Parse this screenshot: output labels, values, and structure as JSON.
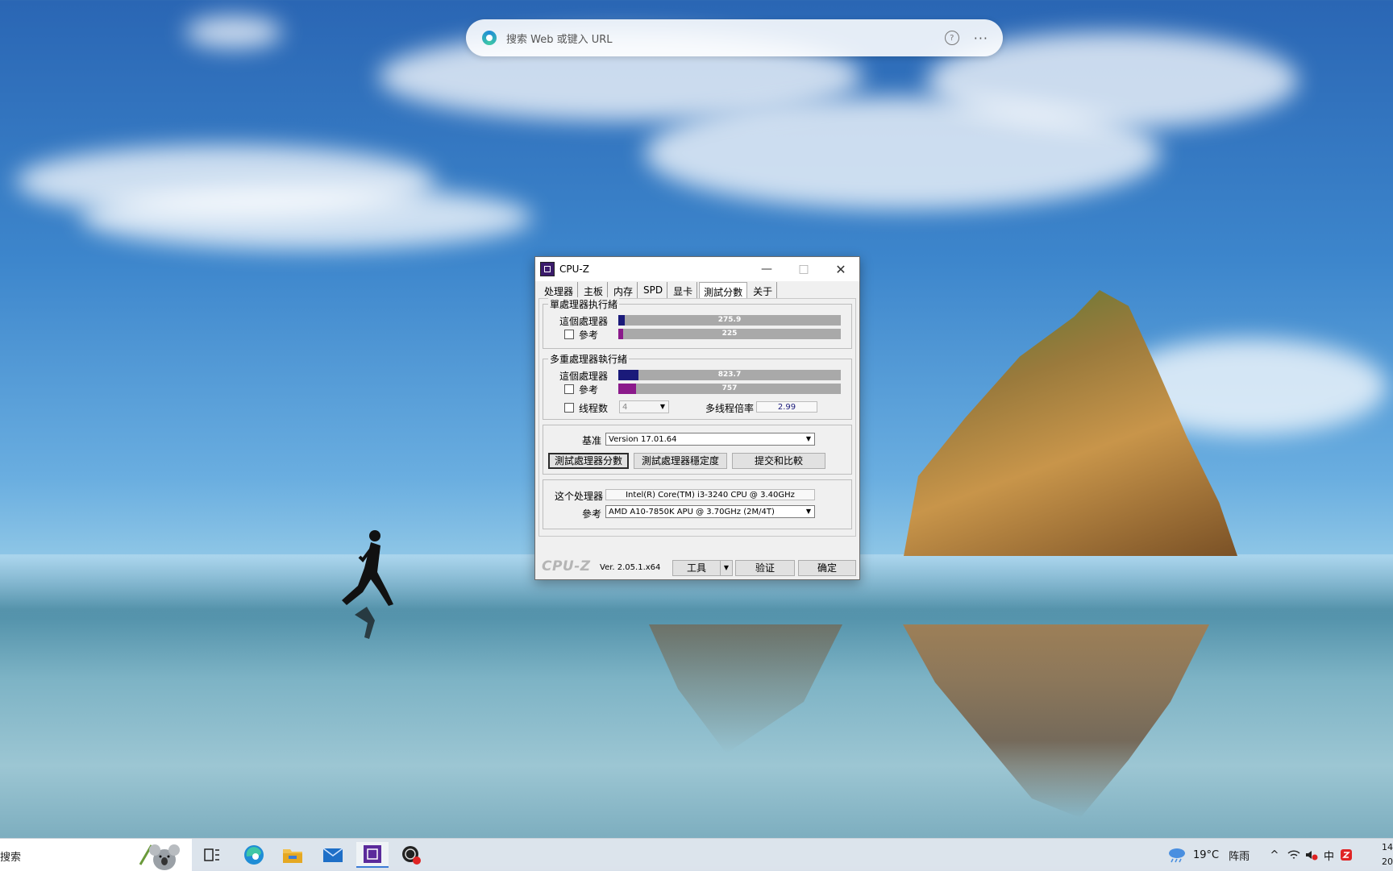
{
  "browser_search": {
    "placeholder": "搜索 Web 或键入 URL",
    "help_icon": "?",
    "more_icon": "···"
  },
  "window": {
    "title": "CPU-Z",
    "minimize": "—",
    "maximize": "□",
    "close": "✕",
    "tabs": [
      "处理器",
      "主板",
      "内存",
      "SPD",
      "显卡",
      "測試分數",
      "关于"
    ],
    "active_tab": "測試分數",
    "single": {
      "group_label": "單處理器执行緒",
      "this_label": "這個處理器",
      "ref_label": "參考",
      "this_value": "275.9",
      "ref_value": "225",
      "this_fill_pct": 3,
      "ref_fill_pct": 2
    },
    "multi": {
      "group_label": "多重處理器執行緒",
      "this_label": "這個處理器",
      "ref_label": "參考",
      "this_value": "823.7",
      "ref_value": "757",
      "this_fill_pct": 9,
      "ref_fill_pct": 8,
      "threads_label": "线程数",
      "threads_value": "4",
      "ratio_label": "多线程倍率",
      "ratio_value": "2.99"
    },
    "baseline": {
      "label": "基准",
      "value": "Version 17.01.64"
    },
    "buttons": {
      "bench_cpu": "測試處理器分數",
      "stress_cpu": "測試處理器穩定度",
      "submit": "提交和比較"
    },
    "cpu_info": {
      "this_label": "这个处理器",
      "this_value": "Intel(R) Core(TM) i3-3240 CPU @ 3.40GHz",
      "ref_label": "參考",
      "ref_value": "AMD A10-7850K APU @ 3.70GHz (2M/4T)"
    },
    "footer": {
      "brand": "CPU-Z",
      "version": "Ver. 2.05.1.x64",
      "tools": "工具",
      "validate": "验证",
      "ok": "确定"
    },
    "colors": {
      "this_bar": "#1a1a7a",
      "ref_bar": "#8b1a8b",
      "bar_bg": "#a9a9a9"
    }
  },
  "taskbar": {
    "search_text": "搜索",
    "weather": "19°C",
    "weather_desc": "阵雨",
    "ime": "中",
    "clock_time": "14",
    "clock_date": "20",
    "apps": [
      "task-view-icon",
      "edge-icon",
      "file-explorer-icon",
      "mail-icon",
      "cpu-z-icon",
      "obs-icon"
    ]
  }
}
